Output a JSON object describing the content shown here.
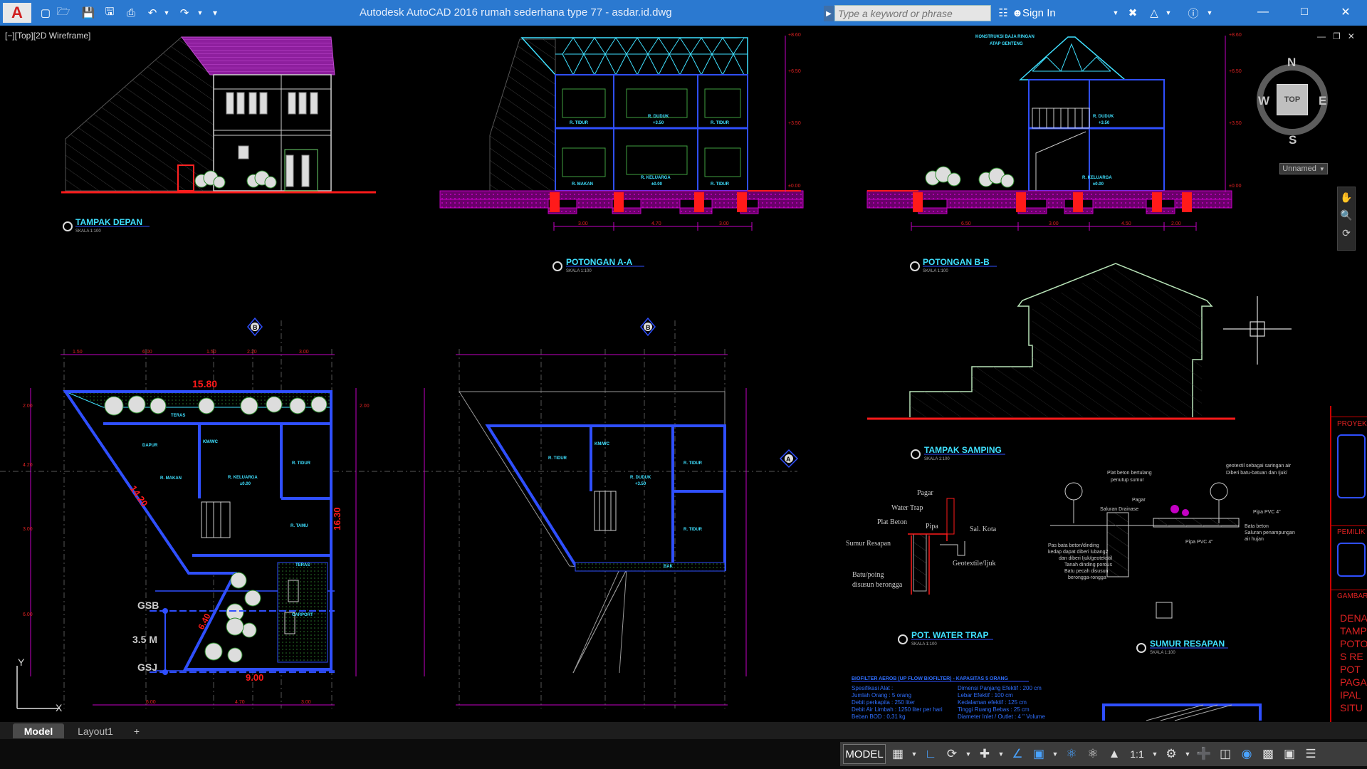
{
  "app": {
    "title": "Autodesk AutoCAD 2016     rumah sederhana type 77 - asdar.id.dwg",
    "logo": "A",
    "sign_in": "Sign In",
    "search_placeholder": "Type a keyword or phrase"
  },
  "viewport": {
    "label": "[−][Top][2D Wireframe]"
  },
  "viewcube": {
    "top_face": "TOP",
    "north": "N",
    "south": "S",
    "east": "E",
    "west": "W",
    "wcs": "Unnamed"
  },
  "drawing_text": {
    "tampak_depan": "TAMPAK DEPAN",
    "potongan_aa": "POTONGAN A-A",
    "potongan_bb": "POTONGAN B-B",
    "tampak_samping": "TAMPAK SAMPING",
    "pot_water_trap": "POT. WATER TRAP",
    "sumur_resapan": "SUMUR RESAPAN",
    "skala": "SKALA 1:100",
    "plan_total_width": "15.80",
    "plan_diag": "14.20",
    "plan_height": "16.30",
    "plan_bottom_width": "9.00",
    "gsb": "GSB",
    "gsj": "GSJ",
    "gap_label": "3.5 M",
    "slant_dim": "6.40",
    "grid_b": "B",
    "grid_a": "A",
    "rooms": {
      "teras": "TERAS",
      "dapur": "DAPUR",
      "kmwc": "KM/WC",
      "k_makan": "R. MAKAN",
      "k_keluarga": "R. KELUARGA",
      "k_tidur": "R. TIDUR",
      "k_tamu": "R. TAMU",
      "carport": "CARPORT",
      "k_duduk": "R. DUDUK",
      "balkon": "BAK"
    },
    "water_trap": {
      "pagar": "Pagar",
      "water_trap": "Water Trap",
      "plat_beton": "Plat Beton",
      "pipa": "Pipa",
      "sal_kota": "Sal. Kota",
      "sumur_resapan": "Sumur Resapan",
      "geotextile": "Geotextile/Ijuk",
      "batu_pojok": "Batu/poing",
      "disusun": "disusun berongga"
    },
    "sumur": {
      "plat_beton": "Plat beton bertulang",
      "penutup": "penutup sumur",
      "pagar": "Pagar",
      "saluran": "Saluran Drainase",
      "geotextil": "geotextil sebagai saringan air",
      "diberi": "Diberi batu-batuan dan Ijuk/",
      "pipa_pvc": "Pipa PVC 4\"",
      "bata_beton": "Bata beton",
      "saluran_penampung": "Saluran penampungan",
      "air_hujan": "air hujan",
      "pas_bata": "Pas bata beton/dinding",
      "kedap": "kedap dapat diberi lubang2",
      "dan_diberi": "dan diberi Ijuk/geotekstil",
      "tanah": "Tanah dinding porous",
      "batu_pecah": "Batu pecah disusun",
      "berongga": "berongga-rongga"
    },
    "spec_title": "BIOFILTER AEROB (UP FLOW BIOFILTER) - KAPASITAS 5 ORANG",
    "spec_left": [
      "Spesifikasi Alat :",
      "Jumlah Orang : 5 orang",
      "Debit perkapita : 250 liter",
      "Debit Air Limbah : 1250 liter per hari",
      "Beban BOD : 0,31 kg"
    ],
    "spec_right": [
      "Dimensi Panjang Efektif : 200 cm",
      "Lebar Efektif : 100 cm",
      "Kedalaman efektif : 125 cm",
      "Tinggi Ruang Bebas : 25 cm",
      "Diameter Inlet / Outlet : 4 \" Volume"
    ],
    "section_rooms": {
      "k_tidur": "R. TIDUR",
      "k_duduk": "R. DUDUK",
      "k_duduk_lvl": "+3.50",
      "k_makan": "R. MAKAN",
      "k_keluarga": "R. KELUARGA",
      "k_keluarga_lvl": "±0.00",
      "konstruksi": "KONSTRUKSI BAJA RINGAN",
      "atap": "ATAP GENTENG"
    },
    "levels": [
      "+8.60",
      "+6.50",
      "+3.50",
      "±0.00"
    ],
    "dims_aa": [
      "3.00",
      "4.70",
      "3.00"
    ],
    "dims_bb": [
      "6.50",
      "3.00",
      "4.50",
      "2.00"
    ],
    "plan_top_dims": [
      "1.50",
      "6.00",
      "1.50",
      "2.20",
      "3.00"
    ],
    "plan_bottom_dims": [
      "6.00",
      "4.70",
      "3.00"
    ],
    "plan_side_dims": [
      "2.00",
      "4.20",
      "3.00",
      "6.00",
      "2.00"
    ]
  },
  "title_block": {
    "proyek": "PROYEK",
    "pemilik": "PEMILIK",
    "gambar": "GAMBAR",
    "items": [
      "DENA",
      "TAMP",
      "POTO",
      "S RE",
      "POT",
      "PAGA",
      "IPAL",
      "SITU"
    ]
  },
  "tabs": {
    "model": "Model",
    "layout1": "Layout1",
    "add": "+"
  },
  "status": {
    "model": "MODEL",
    "scale": "1:1"
  },
  "colors": {
    "titlebar": "#2b79d0",
    "cyan": "#3fe0ff",
    "blue": "#2f4fff",
    "red": "#ff1a1a",
    "magenta": "#c400c4",
    "green": "#39b54a"
  }
}
